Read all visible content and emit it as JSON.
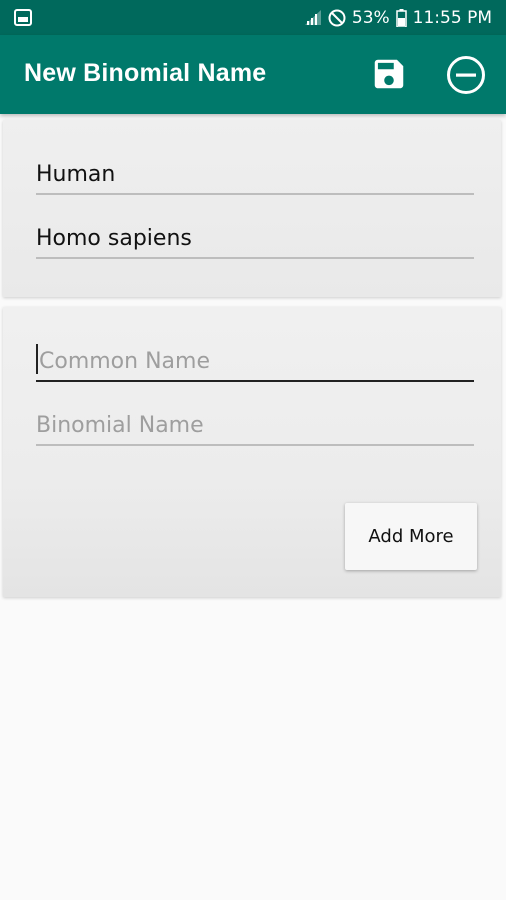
{
  "status_bar": {
    "battery": "53%",
    "time": "11:55 PM",
    "icons": [
      "image-icon",
      "signal-icon",
      "do-not-disturb-icon",
      "battery-icon"
    ]
  },
  "app_bar": {
    "title": "New Binomial Name",
    "actions": [
      "save-icon",
      "remove-circle-icon"
    ],
    "color": "#00796b",
    "status_color": "#00695c"
  },
  "existing_entry": {
    "common_name": "Human",
    "binomial_name": "Homo sapiens"
  },
  "new_entry": {
    "common_name_placeholder": "Common Name",
    "binomial_name_placeholder": "Binomial Name",
    "add_more_label": "Add More"
  }
}
